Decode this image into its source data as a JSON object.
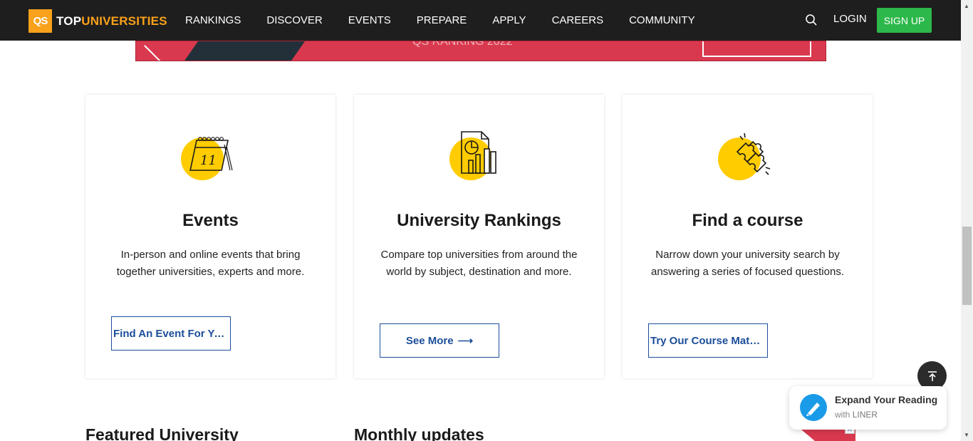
{
  "brand": {
    "qs": "QS",
    "top": "TOP",
    "universities": "UNIVERSITIES"
  },
  "nav": {
    "items": [
      "RANKINGS",
      "DISCOVER",
      "EVENTS",
      "PREPARE",
      "APPLY",
      "CAREERS",
      "COMMUNITY"
    ],
    "login": "LOGIN",
    "signup": "SIGN UP"
  },
  "banner": {
    "text": "QS RANKING 2022"
  },
  "cards": [
    {
      "title": "Events",
      "desc": "In-person and online events that bring together universities, experts and more.",
      "button": "Find An Event For Yo…",
      "icon_text": "11"
    },
    {
      "title": "University Rankings",
      "desc": "Compare top universities from around the world by subject, destination and more.",
      "button": "See More"
    },
    {
      "title": "Find a course",
      "desc": "Narrow down your university search by answering a series of focused questions.",
      "button": "Try Our Course Matc…"
    }
  ],
  "sections": {
    "featured": "Featured University",
    "monthly": "Monthly updates"
  },
  "liner": {
    "title": "Expand Your Reading",
    "with": "with",
    "brand": "LINER"
  },
  "colors": {
    "nav_bg": "#1e1e1e",
    "brand_orange": "#f9a11b",
    "signup_green": "#2db84b",
    "button_blue": "#1c4e9a",
    "icon_yellow": "#ffcc00",
    "banner_red": "#d9394f"
  }
}
